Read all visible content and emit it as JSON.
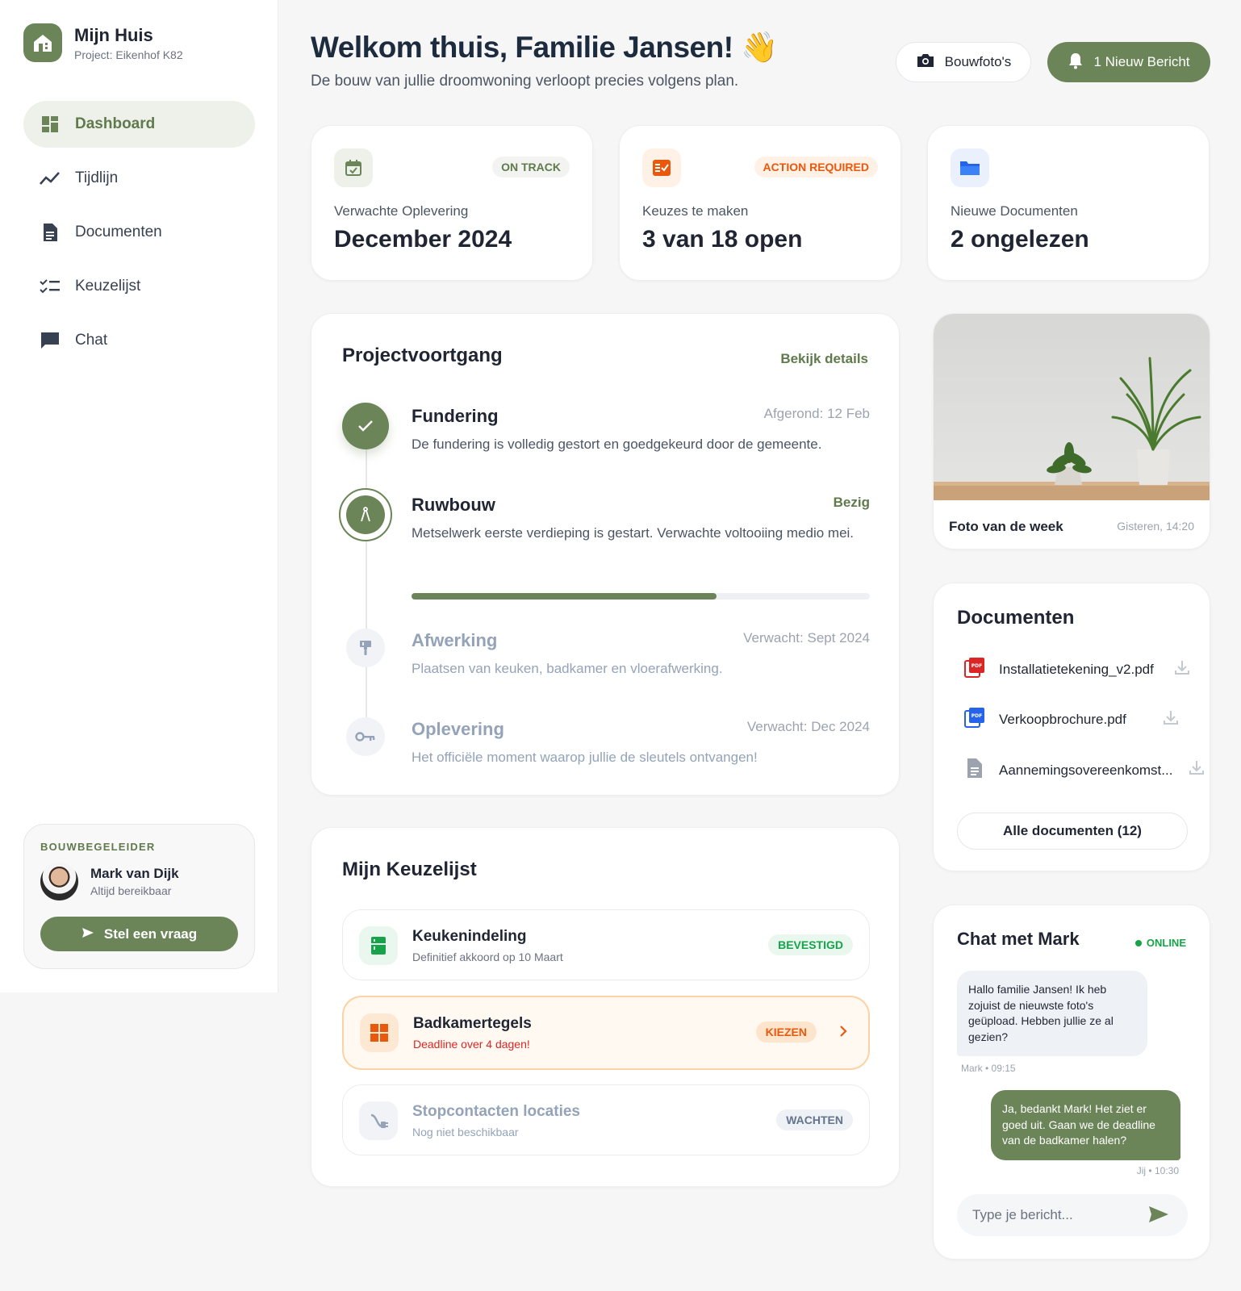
{
  "sidebar": {
    "brand_title": "Mijn Huis",
    "brand_sub": "Project: Eikenhof K82",
    "items": [
      {
        "label": "Dashboard",
        "icon": "dashboard-icon",
        "active": true
      },
      {
        "label": "Tijdlijn",
        "icon": "timeline-icon"
      },
      {
        "label": "Documenten",
        "icon": "document-icon"
      },
      {
        "label": "Keuzelijst",
        "icon": "checklist-icon"
      },
      {
        "label": "Chat",
        "icon": "chat-icon"
      }
    ],
    "advisor": {
      "label": "BOUWBEGELEIDER",
      "name": "Mark van Dijk",
      "status": "Altijd bereikbaar",
      "button": "Stel een vraag"
    }
  },
  "header": {
    "title": "Welkom thuis, Familie Jansen! 👋",
    "subtitle": "De bouw van jullie droomwoning verloopt precies volgens plan.",
    "photos_button": "Bouwfoto's",
    "messages_button": "1 Nieuw Bericht"
  },
  "stats": [
    {
      "label": "Verwachte Oplevering",
      "value": "December 2024",
      "badge": "ON TRACK",
      "icon": "calendar-check-icon"
    },
    {
      "label": "Keuzes te maken",
      "value": "3 van 18 open",
      "badge": "ACTION REQUIRED",
      "icon": "task-list-icon"
    },
    {
      "label": "Nieuwe Documenten",
      "value": "2 ongelezen",
      "badge": "",
      "icon": "folder-icon"
    }
  ],
  "progress": {
    "title": "Projectvoortgang",
    "link": "Bekijk details",
    "steps": [
      {
        "title": "Fundering",
        "meta": "Afgerond: 12 Feb",
        "desc": "De fundering is volledig gestort en goedgekeurd door de gemeente.",
        "state": "done"
      },
      {
        "title": "Ruwbouw",
        "meta": "Bezig",
        "desc": "Metselwerk eerste verdieping is gestart. Verwachte voltooiing medio mei.",
        "state": "active",
        "progress": 0.665
      },
      {
        "title": "Afwerking",
        "meta": "Verwacht: Sept 2024",
        "desc": "Plaatsen van keuken, badkamer en vloerafwerking.",
        "state": "pending"
      },
      {
        "title": "Oplevering",
        "meta": "Verwacht: Dec 2024",
        "desc": "Het officiële moment waarop jullie de sleutels ontvangen!",
        "state": "pending"
      }
    ]
  },
  "choices": {
    "title": "Mijn Keuzelijst",
    "items": [
      {
        "title": "Keukenindeling",
        "sub": "Definitief akkoord op 10 Maart",
        "badge": "BEVESTIGD"
      },
      {
        "title": "Badkamertegels",
        "sub": "Deadline over 4 dagen!",
        "badge": "KIEZEN"
      },
      {
        "title": "Stopcontacten locaties",
        "sub": "Nog niet beschikbaar",
        "badge": "WACHTEN"
      }
    ]
  },
  "photo": {
    "caption": "Foto van de week",
    "time": "Gisteren, 14:20"
  },
  "documents": {
    "title": "Documenten",
    "items": [
      {
        "name": "Installatietekening_v2.pdf",
        "icon": "pdf-red-icon"
      },
      {
        "name": "Verkoopbrochure.pdf",
        "icon": "pdf-blue-icon"
      },
      {
        "name": "Aannemingsovereenkomst...",
        "icon": "file-icon"
      }
    ],
    "all_button": "Alle documenten (12)"
  },
  "chat": {
    "title": "Chat met Mark",
    "status": "ONLINE",
    "messages": [
      {
        "text": "Hallo familie Jansen! Ik heb zojuist de nieuwste foto's geüpload. Hebben jullie ze al gezien?",
        "meta": "Mark • 09:15"
      },
      {
        "text": "Ja, bedankt Mark! Het ziet er goed uit. Gaan we de deadline van de badkamer halen?",
        "meta": "Jij • 10:30"
      }
    ],
    "placeholder": "Type je bericht..."
  },
  "colors": {
    "accent": "#6b8558",
    "warning": "#ea580c",
    "success": "#16a34a",
    "info": "#2563eb"
  }
}
